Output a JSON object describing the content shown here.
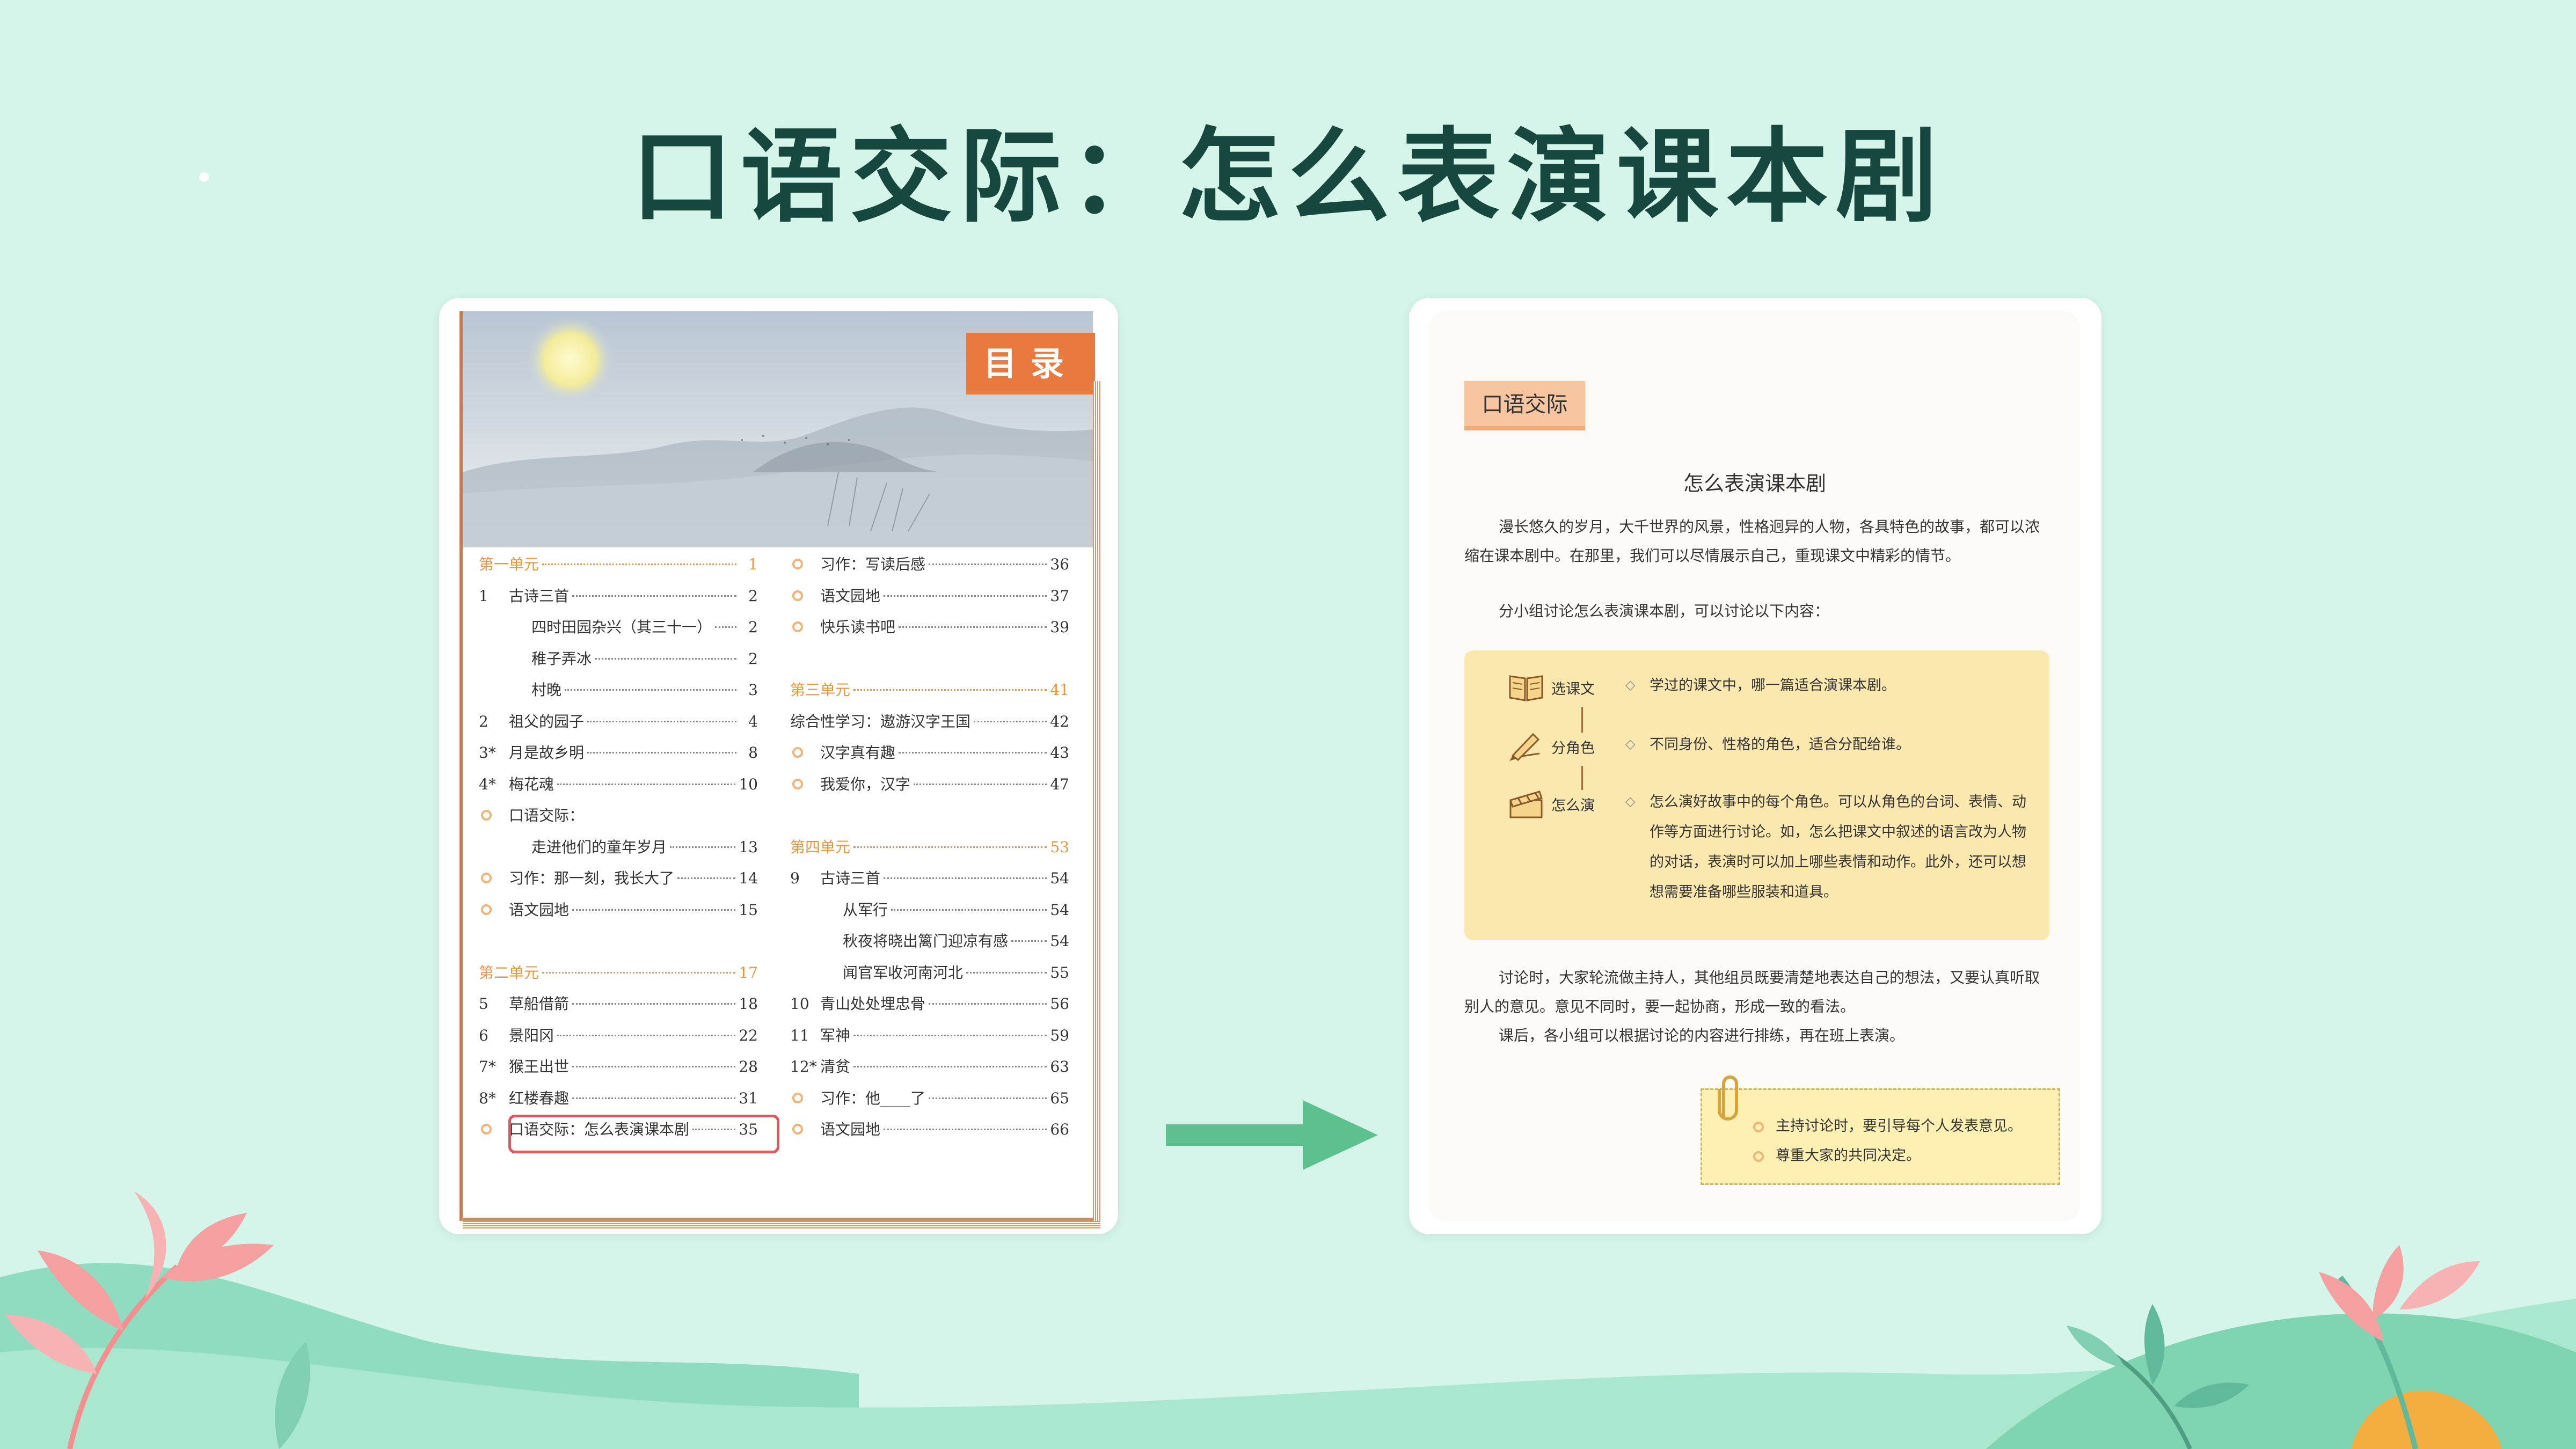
{
  "slide_title": "口语交际：怎么表演课本剧",
  "toc": {
    "badge": "目录",
    "col1": [
      {
        "kind": "unit",
        "text": "第一单元",
        "page": "1"
      },
      {
        "kind": "num",
        "num": "1",
        "text": "古诗三首",
        "page": "2"
      },
      {
        "kind": "sub",
        "text": "四时田园杂兴（其三十一）",
        "page": "2"
      },
      {
        "kind": "sub",
        "text": "稚子弄冰",
        "page": "2"
      },
      {
        "kind": "sub",
        "text": "村晚",
        "page": "3"
      },
      {
        "kind": "num",
        "num": "2",
        "text": "祖父的园子",
        "page": "4"
      },
      {
        "kind": "num",
        "num": "3*",
        "text": "月是故乡明",
        "page": "8"
      },
      {
        "kind": "num",
        "num": "4*",
        "text": "梅花魂",
        "page": "10"
      },
      {
        "kind": "dot",
        "text": "口语交际：",
        "page": ""
      },
      {
        "kind": "sub",
        "text": "走进他们的童年岁月",
        "page": "13"
      },
      {
        "kind": "dot",
        "text": "习作：那一刻，我长大了",
        "page": "14"
      },
      {
        "kind": "dot",
        "text": "语文园地",
        "page": "15"
      },
      {
        "kind": "gap"
      },
      {
        "kind": "unit",
        "text": "第二单元",
        "page": "17"
      },
      {
        "kind": "num",
        "num": "5",
        "text": "草船借箭",
        "page": "18"
      },
      {
        "kind": "num",
        "num": "6",
        "text": "景阳冈",
        "page": "22"
      },
      {
        "kind": "num",
        "num": "7*",
        "text": "猴王出世",
        "page": "28"
      },
      {
        "kind": "num",
        "num": "8*",
        "text": "红楼春趣",
        "page": "31"
      },
      {
        "kind": "dot",
        "text": "口语交际：怎么表演课本剧",
        "page": "35"
      }
    ],
    "col2": [
      {
        "kind": "dot",
        "text": "习作：写读后感",
        "page": "36"
      },
      {
        "kind": "dot",
        "text": "语文园地",
        "page": "37"
      },
      {
        "kind": "dot",
        "text": "快乐读书吧",
        "page": "39"
      },
      {
        "kind": "gap"
      },
      {
        "kind": "unit",
        "text": "第三单元",
        "page": "41"
      },
      {
        "kind": "plain",
        "text": "综合性学习：遨游汉字王国",
        "page": "42"
      },
      {
        "kind": "dot",
        "text": "汉字真有趣",
        "page": "43"
      },
      {
        "kind": "dot",
        "text": "我爱你，汉字",
        "page": "47"
      },
      {
        "kind": "gap"
      },
      {
        "kind": "unit",
        "text": "第四单元",
        "page": "53"
      },
      {
        "kind": "num",
        "num": "9",
        "text": "古诗三首",
        "page": "54"
      },
      {
        "kind": "sub",
        "text": "从军行",
        "page": "54"
      },
      {
        "kind": "sub",
        "text": "秋夜将晓出篱门迎凉有感",
        "page": "54"
      },
      {
        "kind": "sub",
        "text": "闻官军收河南河北",
        "page": "55"
      },
      {
        "kind": "num",
        "num": "10",
        "text": "青山处处埋忠骨",
        "page": "56"
      },
      {
        "kind": "num",
        "num": "11",
        "text": "军神",
        "page": "59"
      },
      {
        "kind": "num",
        "num": "12*",
        "text": "清贫",
        "page": "63"
      },
      {
        "kind": "dot",
        "text": "习作：他____了",
        "page": "65"
      },
      {
        "kind": "dot",
        "text": "语文园地",
        "page": "66"
      }
    ]
  },
  "lesson": {
    "tag": "口语交际",
    "title": "怎么表演课本剧",
    "para1": "漫长悠久的岁月，大千世界的风景，性格迥异的人物，各具特色的故事，都可以浓缩在课本剧中。在那里，我们可以尽情展示自己，重现课文中精彩的情节。",
    "para2": "分小组讨论怎么表演课本剧，可以讨论以下内容：",
    "steps": [
      {
        "label": "选课文",
        "desc": "学过的课文中，哪一篇适合演课本剧。",
        "icon": "book-icon"
      },
      {
        "label": "分角色",
        "desc": "不同身份、性格的角色，适合分配给谁。",
        "icon": "pen-icon"
      },
      {
        "label": "怎么演",
        "desc": "怎么演好故事中的每个角色。可以从角色的台词、表情、动作等方面进行讨论。如，怎么把课文中叙述的语言改为人物的对话，表演时可以加上哪些表情和动作。此外，还可以想想需要准备哪些服装和道具。",
        "icon": "clapperboard-icon"
      }
    ],
    "para3": "讨论时，大家轮流做主持人，其他组员既要清楚地表达自己的想法，又要认真听取别人的意见。意见不同时，要一起协商，形成一致的看法。",
    "para4": "课后，各小组可以根据讨论的内容进行排练，再在班上表演。",
    "tips": [
      "主持讨论时，要引导每个人发表意见。",
      "尊重大家的共同决定。"
    ]
  },
  "colors": {
    "title": "#17483f",
    "background": "#d6f5ea",
    "arrow": "#5cc08f",
    "highlight": "#e0575b",
    "accent": "#e8793f"
  }
}
